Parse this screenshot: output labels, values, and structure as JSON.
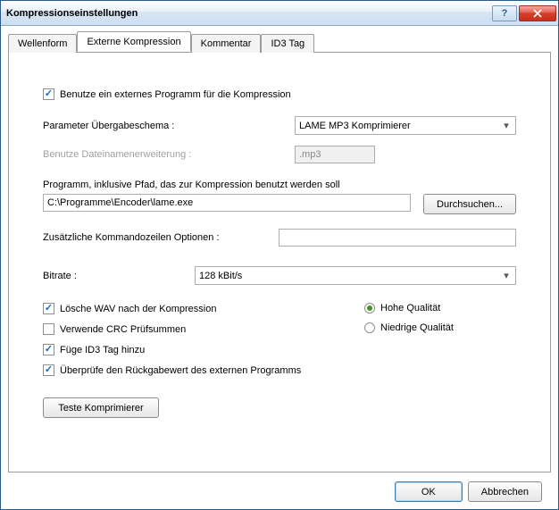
{
  "window": {
    "title": "Kompressionseinstellungen"
  },
  "tabs": {
    "wellenform": "Wellenform",
    "externe": "Externe Kompression",
    "kommentar": "Kommentar",
    "id3": "ID3 Tag"
  },
  "form": {
    "use_external_label": "Benutze ein externes Programm für die Kompression",
    "param_scheme_label": "Parameter Übergabeschema :",
    "param_scheme_value": "LAME MP3 Komprimierer",
    "ext_label": "Benutze Dateinamenerweiterung :",
    "ext_value": ".mp3",
    "program_path_label": "Programm, inklusive Pfad, das zur Kompression benutzt werden soll",
    "program_path_value": "C:\\Programme\\Encoder\\lame.exe",
    "browse_btn": "Durchsuchen...",
    "extra_cmd_label": "Zusätzliche Kommandozeilen Optionen :",
    "extra_cmd_value": "",
    "bitrate_label": "Bitrate :",
    "bitrate_value": "128 kBit/s",
    "delete_wav_label": "Lösche WAV nach der Kompression",
    "crc_label": "Verwende CRC Prüfsummen",
    "id3_label": "Füge ID3 Tag hinzu",
    "check_return_label": "Überprüfe den Rückgabewert des externen Programms",
    "high_q_label": "Hohe Qualität",
    "low_q_label": "Niedrige Qualität",
    "test_btn": "Teste Komprimierer"
  },
  "footer": {
    "ok": "OK",
    "cancel": "Abbrechen"
  }
}
